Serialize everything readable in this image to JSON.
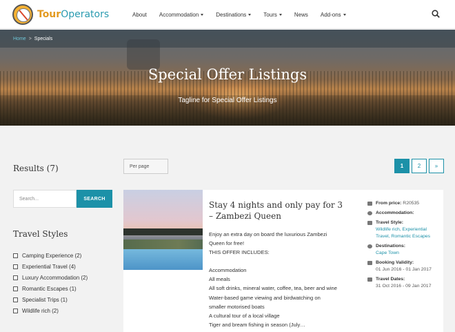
{
  "header": {
    "logo_part1": "Tour",
    "logo_part2": "Operators",
    "nav": [
      {
        "label": "About",
        "dropdown": false
      },
      {
        "label": "Accommodation",
        "dropdown": true
      },
      {
        "label": "Destinations",
        "dropdown": true
      },
      {
        "label": "Tours",
        "dropdown": true
      },
      {
        "label": "News",
        "dropdown": false
      },
      {
        "label": "Add-ons",
        "dropdown": true
      }
    ],
    "search_icon": "search-icon"
  },
  "breadcrumb": {
    "home": "Home",
    "separator": ">",
    "current": "Specials"
  },
  "hero": {
    "title": "Special Offer Listings",
    "tagline": "Tagline for Special Offer Listings"
  },
  "sidebar": {
    "results": "Results (7)",
    "search_placeholder": "Search...",
    "search_button": "SEARCH",
    "styles_title": "Travel Styles",
    "styles": [
      "Camping Experience (2)",
      "Experiential Travel (4)",
      "Luxury Accommodation (2)",
      "Romantic Escapes (1)",
      "Specialist Trips (1)",
      "Wildlife rich (2)"
    ]
  },
  "toolbar": {
    "per_page": "Per page",
    "pages": [
      "1",
      "2",
      "»"
    ],
    "active_page": "1"
  },
  "listing": {
    "title": "Stay 4 nights and only pay for 3 – Zambezi Queen",
    "body": [
      "Enjoy an extra day on board the luxurious Zambezi",
      "Queen for free!",
      "THIS OFFER INCLUDES:",
      "",
      "Accommodation",
      "All meals",
      "All soft drinks, mineral water, coffee, tea, beer and wine",
      "Water-based game viewing and birdwatching on",
      "smaller motorised boats",
      "A cultural tour of a local village",
      "Tiger and bream fishing in season (July…"
    ],
    "meta": {
      "price_label": "From price:",
      "price_value": "R20535",
      "accommodation_label": "Accommodation:",
      "travel_style_label": "Travel Style:",
      "travel_style_value": "Wildlife rich, Experiential Travel, Romantic Escapes",
      "destinations_label": "Destinations:",
      "destinations_value": "Cape Town",
      "booking_label": "Booking Validity:",
      "booking_value": "01 Jun 2016 - 01 Jan 2017",
      "travel_dates_label": "Travel Dates:",
      "travel_dates_value": "31 Oct 2016 - 09 Jan 2017"
    }
  },
  "colors": {
    "accent": "#1c91a8",
    "logo_orange": "#e39a20"
  }
}
